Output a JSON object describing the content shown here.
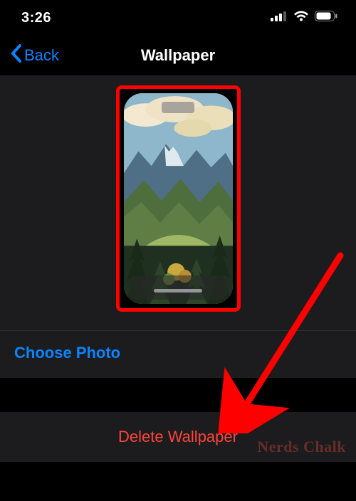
{
  "status": {
    "time": "3:26",
    "icons": {
      "cellular": "cellular-icon",
      "wifi": "wifi-icon",
      "battery": "battery-icon"
    }
  },
  "nav": {
    "back_label": "Back",
    "title": "Wallpaper"
  },
  "preview": {
    "description": "Illustrated mountain landscape wallpaper preview",
    "highlighted": true
  },
  "actions": {
    "choose_photo_label": "Choose Photo",
    "delete_label": "Delete Wallpaper"
  },
  "watermark": "Nerds Chalk",
  "annotation": {
    "arrow_color": "#ff0000"
  },
  "colors": {
    "link": "#0b84ff",
    "destructive": "#ff443a",
    "highlight": "#ff0000",
    "panel": "#1c1c1e"
  }
}
